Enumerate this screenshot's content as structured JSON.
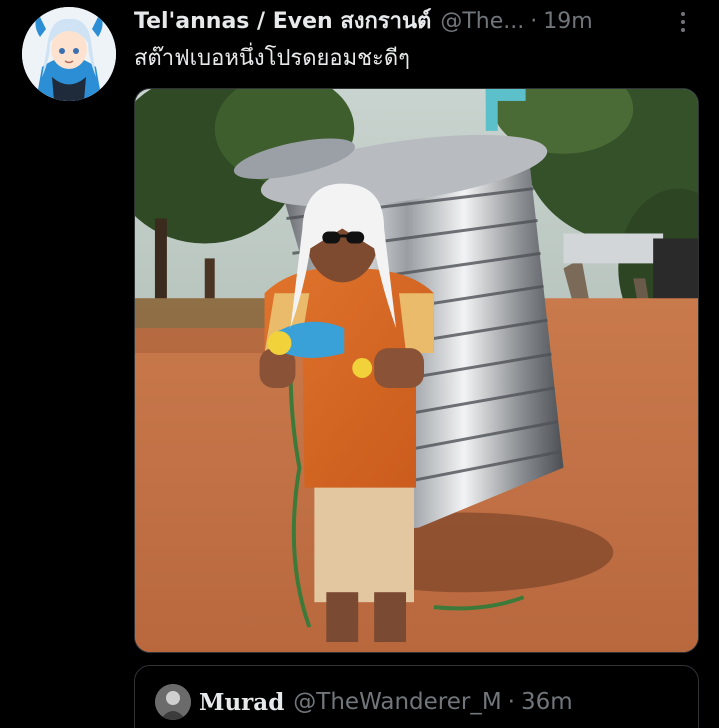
{
  "tweet": {
    "display_name": "Tel'annas / Even สงกรานต์",
    "handle": "@The...",
    "separator": "·",
    "time": "19m",
    "text": "สต๊าฟเบอหนึ่งโปรดยอมชะดีๆ",
    "more_icon": "more-vertical-icon"
  },
  "quote": {
    "display_name": "Murad",
    "handle": "@TheWanderer_M",
    "separator": "·",
    "time": "36m"
  },
  "colors": {
    "background": "#000000",
    "primary_text": "#e7e9ea",
    "secondary_text": "#71767b",
    "border": "#2f3336"
  }
}
